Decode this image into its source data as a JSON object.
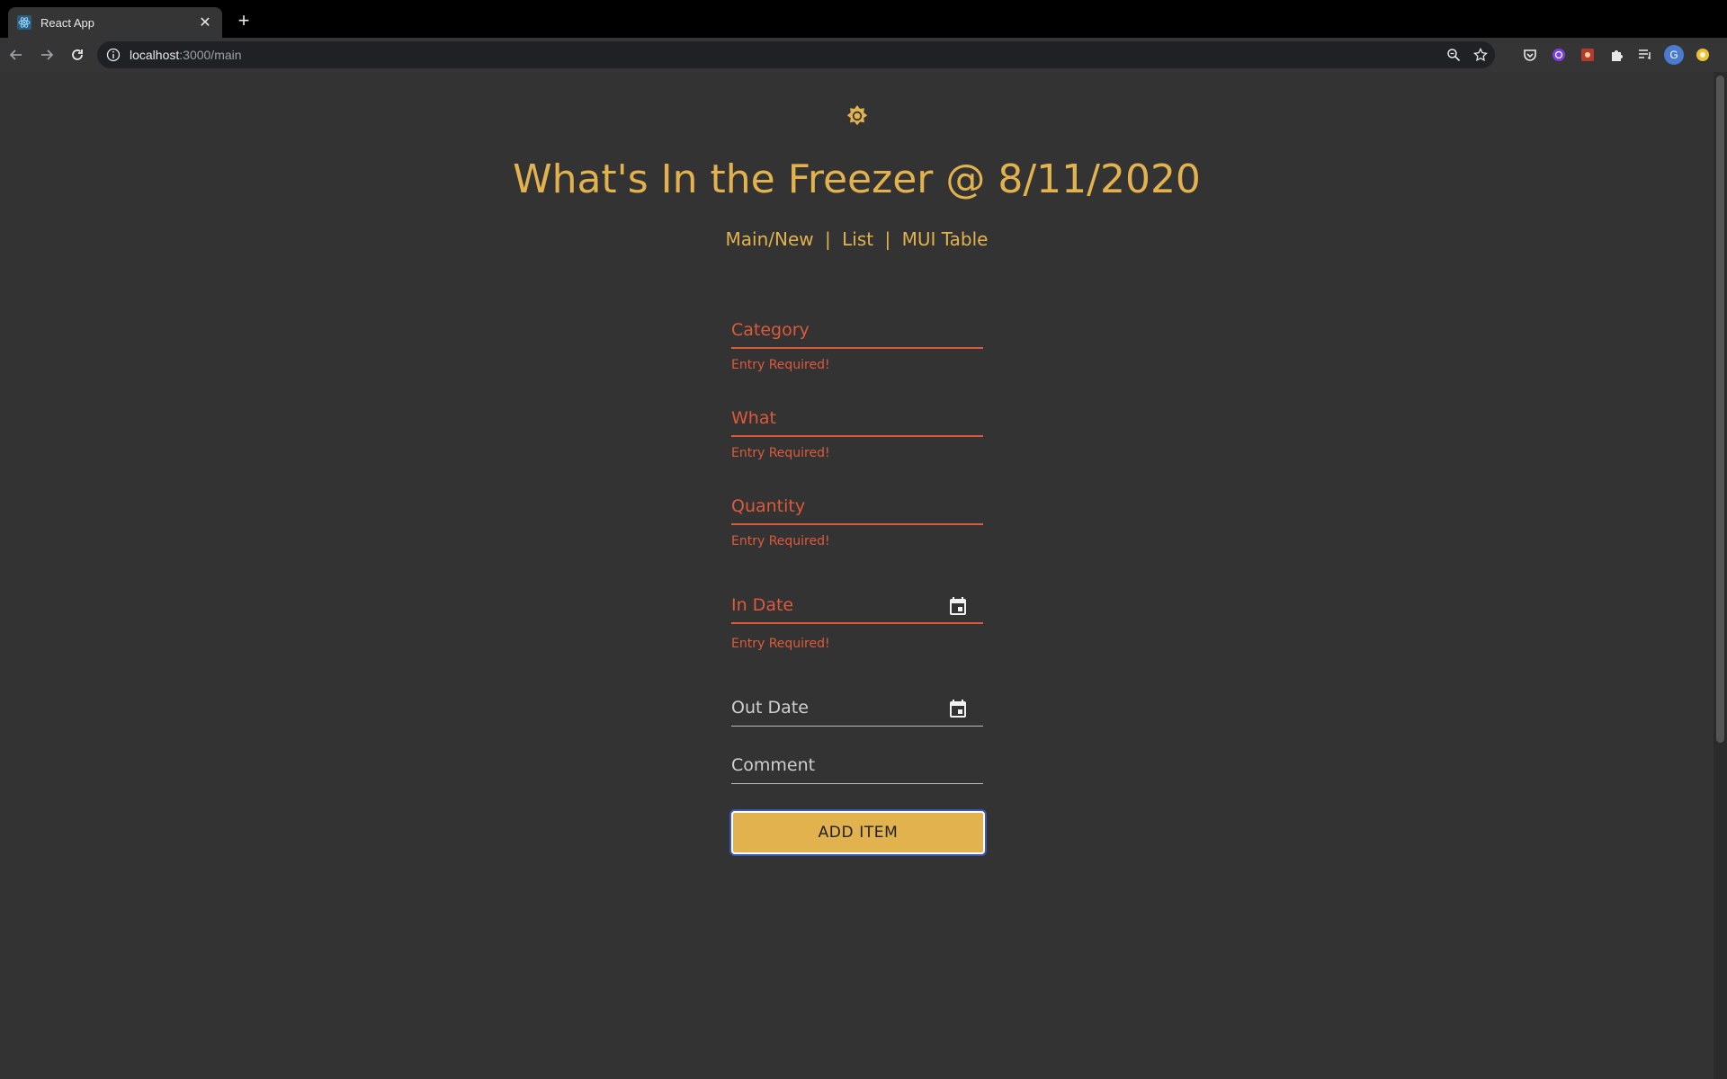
{
  "browser": {
    "tab_title": "React App",
    "url_host": "localhost",
    "url_path": ":3000/main",
    "avatar_letter": "G"
  },
  "page": {
    "theme_icon": "sun-icon",
    "title": "What's In the Freezer @ 8/11/2020",
    "nav": {
      "main": "Main/New",
      "list": "List",
      "table": "MUI Table",
      "separator": "|"
    }
  },
  "form": {
    "category_label": "Category",
    "category_error": "Entry Required!",
    "what_label": "What",
    "what_error": "Entry Required!",
    "quantity_label": "Quantity",
    "quantity_error": "Entry Required!",
    "in_date_label": "In Date",
    "in_date_error": "Entry Required!",
    "out_date_label": "Out Date",
    "comment_label": "Comment",
    "submit_label": "ADD ITEM"
  },
  "colors": {
    "accent": "#e2b24f",
    "error": "#dc5a3c",
    "background": "#333333"
  }
}
